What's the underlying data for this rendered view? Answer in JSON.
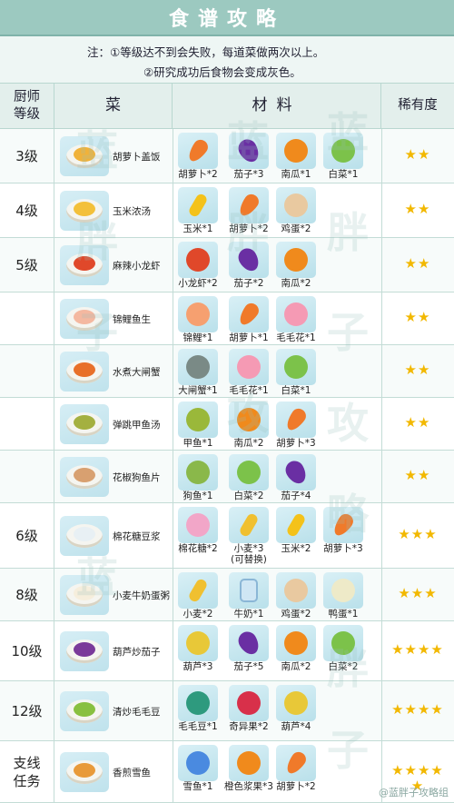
{
  "title": "食谱攻略",
  "notes": {
    "line1": "注：①等级达不到会失败，每道菜做两次以上。",
    "line2": "②研究成功后食物会变成灰色。"
  },
  "headers": {
    "level": "厨师等级",
    "dish": "菜",
    "materials": "材料",
    "rarity": "稀有度"
  },
  "rows": [
    {
      "level": "3级",
      "dish": "胡萝卜盖饭",
      "dish_color": "#f0b23a",
      "stars": "★★",
      "ingredients": [
        {
          "name": "胡萝卜*2",
          "icon": "carrot-icon",
          "color": "#f07a2a"
        },
        {
          "name": "茄子*3",
          "icon": "eggplant-icon",
          "color": "#6a2fa3"
        },
        {
          "name": "南瓜*1",
          "icon": "pumpkin-icon",
          "color": "#f08a1c"
        },
        {
          "name": "白菜*1",
          "icon": "cabbage-icon",
          "color": "#7cc24a"
        }
      ]
    },
    {
      "level": "4级",
      "dish": "玉米浓汤",
      "dish_color": "#f3c03a",
      "stars": "★★",
      "ingredients": [
        {
          "name": "玉米*1",
          "icon": "corn-icon",
          "color": "#f4c21a"
        },
        {
          "name": "胡萝卜*2",
          "icon": "carrot-icon",
          "color": "#f07a2a"
        },
        {
          "name": "鸡蛋*2",
          "icon": "egg-icon",
          "color": "#e9c9a0"
        }
      ]
    },
    {
      "level": "5级",
      "dish": "麻辣小龙虾",
      "dish_color": "#e0482a",
      "stars": "★★",
      "ingredients": [
        {
          "name": "小龙虾*2",
          "icon": "crayfish-icon",
          "color": "#e0482a"
        },
        {
          "name": "茄子*2",
          "icon": "eggplant-icon",
          "color": "#6a2fa3"
        },
        {
          "name": "南瓜*2",
          "icon": "pumpkin-icon",
          "color": "#f08a1c"
        }
      ]
    },
    {
      "level": "",
      "dish": "锦鲤鱼生",
      "dish_color": "#f4b8a0",
      "stars": "★★",
      "ingredients": [
        {
          "name": "锦鲤*1",
          "icon": "koi-icon",
          "color": "#f6a070"
        },
        {
          "name": "胡萝卜*1",
          "icon": "carrot-icon",
          "color": "#f07a2a"
        },
        {
          "name": "毛毛花*1",
          "icon": "fuzzy-flower-icon",
          "color": "#f59ab4"
        }
      ]
    },
    {
      "level": "",
      "dish": "水煮大闸蟹",
      "dish_color": "#e8702a",
      "stars": "★★",
      "ingredients": [
        {
          "name": "大闸蟹*1",
          "icon": "crab-icon",
          "color": "#7a8a86"
        },
        {
          "name": "毛毛花*1",
          "icon": "fuzzy-flower-icon",
          "color": "#f59ab4"
        },
        {
          "name": "白菜*1",
          "icon": "cabbage-icon",
          "color": "#7cc24a"
        }
      ]
    },
    {
      "level": "",
      "dish": "弹跳甲鱼汤",
      "dish_color": "#a4b040",
      "stars": "★★",
      "ingredients": [
        {
          "name": "甲鱼*1",
          "icon": "turtle-icon",
          "color": "#9ab83a"
        },
        {
          "name": "南瓜*2",
          "icon": "pumpkin-icon",
          "color": "#f08a1c"
        },
        {
          "name": "胡萝卜*3",
          "icon": "carrot-icon",
          "color": "#f07a2a"
        }
      ]
    },
    {
      "level": "",
      "dish": "花椒狗鱼片",
      "dish_color": "#d8a070",
      "stars": "★★",
      "ingredients": [
        {
          "name": "狗鱼*1",
          "icon": "pike-fish-icon",
          "color": "#8ab84a"
        },
        {
          "name": "白菜*2",
          "icon": "cabbage-icon",
          "color": "#7cc24a"
        },
        {
          "name": "茄子*4",
          "icon": "eggplant-icon",
          "color": "#6a2fa3"
        }
      ]
    },
    {
      "level": "6级",
      "dish": "棉花糖豆浆",
      "dish_color": "#e8f0f4",
      "stars": "★★★",
      "ingredients": [
        {
          "name": "棉花糖*2",
          "icon": "marshmallow-icon",
          "color": "#f2a6c8"
        },
        {
          "name": "小麦*3\n(可替换)",
          "icon": "wheat-icon",
          "color": "#f0c030"
        },
        {
          "name": "玉米*2",
          "icon": "corn-icon",
          "color": "#f4c21a"
        },
        {
          "name": "胡萝卜*3",
          "icon": "carrot-icon",
          "color": "#f07a2a"
        }
      ]
    },
    {
      "level": "8级",
      "dish": "小麦牛奶蛋粥",
      "dish_color": "#f6eedc",
      "stars": "★★★",
      "ingredients": [
        {
          "name": "小麦*2",
          "icon": "wheat-icon",
          "color": "#f0c030"
        },
        {
          "name": "牛奶*1",
          "icon": "milk-icon",
          "color": "#cfe6f4"
        },
        {
          "name": "鸡蛋*2",
          "icon": "egg-icon",
          "color": "#e9c9a0"
        },
        {
          "name": "鸭蛋*1",
          "icon": "duck-egg-icon",
          "color": "#eeeac8"
        }
      ]
    },
    {
      "level": "10级",
      "dish": "葫芦炒茄子",
      "dish_color": "#7a3a9a",
      "stars": "★★★★",
      "ingredients": [
        {
          "name": "葫芦*3",
          "icon": "gourd-icon",
          "color": "#e8c838"
        },
        {
          "name": "茄子*5",
          "icon": "eggplant-icon",
          "color": "#6a2fa3"
        },
        {
          "name": "南瓜*2",
          "icon": "pumpkin-icon",
          "color": "#f08a1c"
        },
        {
          "name": "白菜*2",
          "icon": "cabbage-icon",
          "color": "#7cc24a"
        }
      ]
    },
    {
      "level": "12级",
      "dish": "清炒毛毛豆",
      "dish_color": "#88c040",
      "stars": "★★★★",
      "ingredients": [
        {
          "name": "毛毛豆*1",
          "icon": "fuzzy-bean-icon",
          "color": "#2e9a7e"
        },
        {
          "name": "奇异果*2",
          "icon": "exotic-fruit-icon",
          "color": "#d8304a"
        },
        {
          "name": "葫芦*4",
          "icon": "gourd-icon",
          "color": "#e8c838"
        }
      ]
    },
    {
      "level": "支线\n任务",
      "dish": "香煎雪鱼",
      "dish_color": "#e89a3a",
      "stars": "★★★★\n★",
      "ingredients": [
        {
          "name": "雪鱼*1",
          "icon": "snow-fish-icon",
          "color": "#4a8ae0"
        },
        {
          "name": "橙色浆果*3",
          "icon": "orange-berry-icon",
          "color": "#f08a1c"
        },
        {
          "name": "胡萝卜*2",
          "icon": "carrot-icon",
          "color": "#f07a2a"
        }
      ]
    }
  ],
  "watermark": "蓝胖子攻略组",
  "footer": "@蓝胖子攻略组",
  "colors": {
    "header_bg": "#9cc9c0",
    "star": "#f2b800",
    "grid": "#c3dcd6"
  }
}
